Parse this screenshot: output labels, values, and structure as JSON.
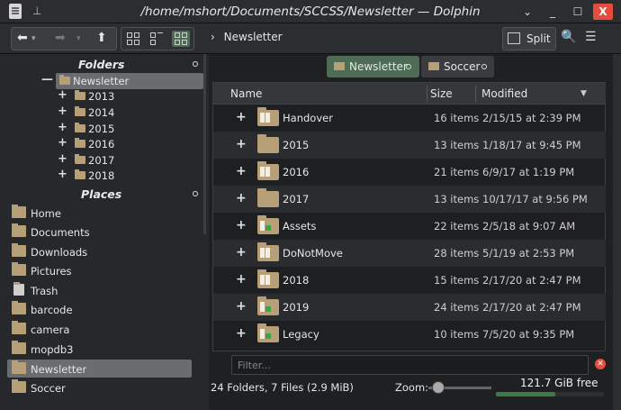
{
  "window": {
    "title": "/home/mshort/Documents/SCCSS/Newsletter — Dolphin",
    "controls": {
      "shade": "⌄",
      "minimize": "_",
      "maximize": "☐",
      "close": "X"
    }
  },
  "toolbar": {
    "back_icon": "back-arrow-icon",
    "forward_icon": "forward-arrow-icon",
    "up_icon": "up-arrow-icon",
    "breadcrumb_sep": "›",
    "breadcrumb": "Newsletter",
    "split_label": "Split",
    "active_view": "details"
  },
  "folders_panel": {
    "title": "Folders",
    "items": [
      {
        "label": "Newsletter",
        "expander": "—",
        "selected": true
      },
      {
        "label": "2013",
        "expander": "+"
      },
      {
        "label": "2014",
        "expander": "+"
      },
      {
        "label": "2015",
        "expander": "+"
      },
      {
        "label": "2016",
        "expander": "+"
      },
      {
        "label": "2017",
        "expander": "+"
      },
      {
        "label": "2018",
        "expander": "+"
      }
    ]
  },
  "places_panel": {
    "title": "Places",
    "items": [
      {
        "label": "Home",
        "icon": "home-folder-icon"
      },
      {
        "label": "Documents",
        "icon": "documents-folder-icon"
      },
      {
        "label": "Downloads",
        "icon": "downloads-folder-icon"
      },
      {
        "label": "Pictures",
        "icon": "pictures-folder-icon"
      },
      {
        "label": "Trash",
        "icon": "trash-icon"
      },
      {
        "label": "barcode",
        "icon": "folder-icon"
      },
      {
        "label": "camera",
        "icon": "folder-icon"
      },
      {
        "label": "mopdb3",
        "icon": "folder-icon"
      },
      {
        "label": "Newsletter",
        "icon": "folder-icon",
        "selected": true
      },
      {
        "label": "Soccer",
        "icon": "folder-icon"
      }
    ]
  },
  "tabs": [
    {
      "label": "Newsletter",
      "active": true
    },
    {
      "label": "Soccer",
      "active": false
    }
  ],
  "table": {
    "columns": {
      "name": "Name",
      "size": "Size",
      "modified": "Modified"
    },
    "rows": [
      {
        "name": "Handover",
        "size": "16 items",
        "modified": "2/15/15 at 2:39 PM",
        "thumb": "docs"
      },
      {
        "name": "2015",
        "size": "13 items",
        "modified": "1/18/17 at 9:45 PM",
        "thumb": "plain"
      },
      {
        "name": "2016",
        "size": "21 items",
        "modified": "6/9/17 at 1:19 PM",
        "thumb": "docs"
      },
      {
        "name": "2017",
        "size": "13 items",
        "modified": "10/17/17 at 9:56 PM",
        "thumb": "plain"
      },
      {
        "name": "Assets",
        "size": "22 items",
        "modified": "2/5/18 at 9:07 AM",
        "thumb": "green"
      },
      {
        "name": "DoNotMove",
        "size": "28 items",
        "modified": "5/1/19 at 2:53 PM",
        "thumb": "docs"
      },
      {
        "name": "2018",
        "size": "15 items",
        "modified": "2/17/20 at 2:47 PM",
        "thumb": "docs"
      },
      {
        "name": "2019",
        "size": "24 items",
        "modified": "2/17/20 at 2:47 PM",
        "thumb": "green"
      },
      {
        "name": "Legacy",
        "size": "10 items",
        "modified": "7/5/20 at 9:35 PM",
        "thumb": "green"
      }
    ]
  },
  "filter": {
    "placeholder": "Filter..."
  },
  "status": {
    "summary": "24 Folders, 7 Files (2.9 MiB)",
    "zoom_label": "Zoom:",
    "free_space": "121.7 GiB free",
    "disk_used_fraction": 0.55
  },
  "colors": {
    "accent": "#4d6b55",
    "folder": "#b79f78",
    "close": "#e74c3c"
  }
}
